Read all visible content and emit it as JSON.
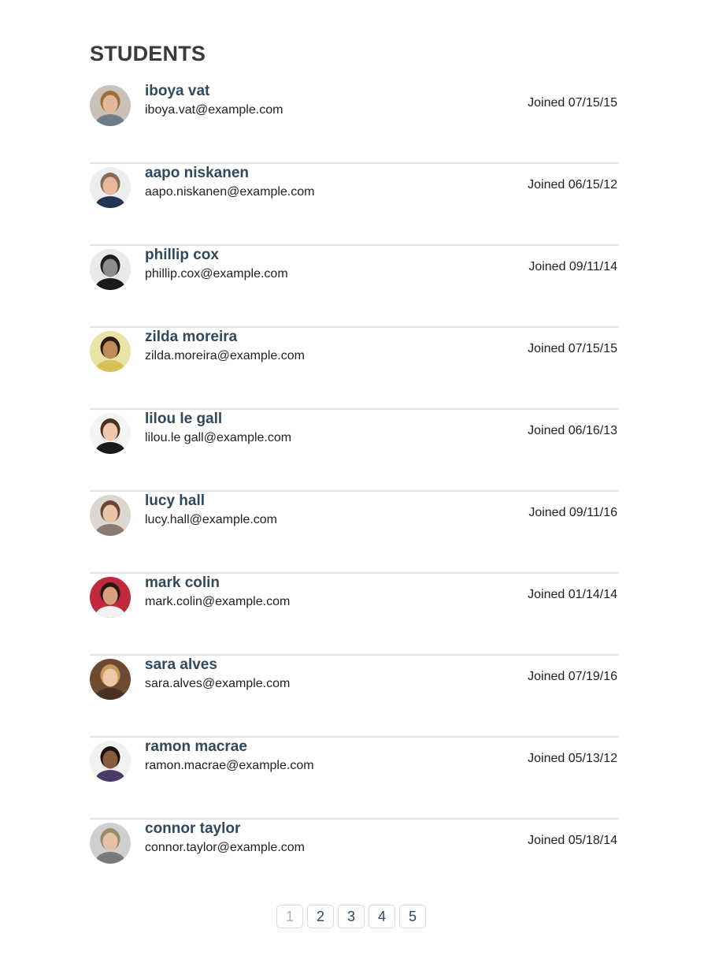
{
  "heading": "STUDENTS",
  "students": [
    {
      "name": "iboya vat",
      "email": "iboya.vat@example.com",
      "joined": "Joined 07/15/15",
      "avatar_icon": "avatar-woman-icon",
      "bg": "#c9c0b8",
      "skin": "#e2b89c",
      "hair": "#a06c3a",
      "shirt": "#6f7d86"
    },
    {
      "name": "aapo niskanen",
      "email": "aapo.niskanen@example.com",
      "joined": "Joined 06/15/12",
      "avatar_icon": "avatar-man-icon",
      "bg": "#eeeeee",
      "skin": "#e7b899",
      "hair": "#8a6a52",
      "shirt": "#233553"
    },
    {
      "name": "phillip cox",
      "email": "phillip.cox@example.com",
      "joined": "Joined 09/11/14",
      "avatar_icon": "avatar-man-icon",
      "bg": "#eaeaea",
      "skin": "#8c8c8c",
      "hair": "#1e1e1e",
      "shirt": "#1a1a1a"
    },
    {
      "name": "zilda moreira",
      "email": "zilda.moreira@example.com",
      "joined": "Joined 07/15/15",
      "avatar_icon": "avatar-woman-icon",
      "bg": "#e9e3a6",
      "skin": "#c08a5a",
      "hair": "#2b1b12",
      "shirt": "#d7c05a"
    },
    {
      "name": "lilou le gall",
      "email": "lilou.le gall@example.com",
      "joined": "Joined 06/16/13",
      "avatar_icon": "avatar-woman-icon",
      "bg": "#f4f4f4",
      "skin": "#efc7ad",
      "hair": "#4e2e1c",
      "shirt": "#1a1a1a"
    },
    {
      "name": "lucy hall",
      "email": "lucy.hall@example.com",
      "joined": "Joined 09/11/16",
      "avatar_icon": "avatar-woman-icon",
      "bg": "#dcd6d0",
      "skin": "#eac4a8",
      "hair": "#6b4630",
      "shirt": "#8b7a70"
    },
    {
      "name": "mark colin",
      "email": "mark.colin@example.com",
      "joined": "Joined 01/14/14",
      "avatar_icon": "avatar-woman-icon",
      "bg": "#c0283c",
      "skin": "#d9a07e",
      "hair": "#2a1a14",
      "shirt": "#f2f2f2"
    },
    {
      "name": "sara alves",
      "email": "sara.alves@example.com",
      "joined": "Joined 07/19/16",
      "avatar_icon": "avatar-woman-icon",
      "bg": "#6e4a30",
      "skin": "#eec6a8",
      "hair": "#c79a5a",
      "shirt": "#4a3222"
    },
    {
      "name": "ramon macrae",
      "email": "ramon.macrae@example.com",
      "joined": "Joined 05/13/12",
      "avatar_icon": "avatar-man-icon",
      "bg": "#f1f1f1",
      "skin": "#8a5a3e",
      "hair": "#1c1410",
      "shirt": "#4a3a66"
    },
    {
      "name": "connor taylor",
      "email": "connor.taylor@example.com",
      "joined": "Joined 05/18/14",
      "avatar_icon": "avatar-man-icon",
      "bg": "#cfcfcf",
      "skin": "#e4c0a4",
      "hair": "#9a8a6a",
      "shirt": "#7a7a7a"
    }
  ],
  "pagination": {
    "pages": [
      "1",
      "2",
      "3",
      "4",
      "5"
    ],
    "current": "1"
  }
}
